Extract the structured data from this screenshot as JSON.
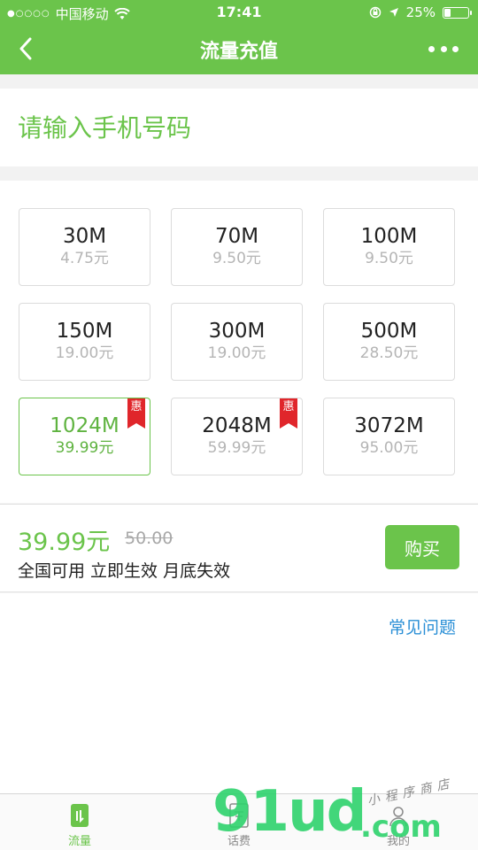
{
  "status_bar": {
    "carrier": "中国移动",
    "time": "17:41",
    "battery": "25%",
    "battery_level": 0.25
  },
  "nav": {
    "title": "流量充值",
    "back_icon": "chevron-left-icon",
    "more_icon": "more-dots-icon"
  },
  "phone": {
    "placeholder": "请输入手机号码",
    "value": ""
  },
  "packages": [
    {
      "size": "30M",
      "price": "4.75元",
      "selected": false,
      "badge": ""
    },
    {
      "size": "70M",
      "price": "9.50元",
      "selected": false,
      "badge": ""
    },
    {
      "size": "100M",
      "price": "9.50元",
      "selected": false,
      "badge": ""
    },
    {
      "size": "150M",
      "price": "19.00元",
      "selected": false,
      "badge": ""
    },
    {
      "size": "300M",
      "price": "19.00元",
      "selected": false,
      "badge": ""
    },
    {
      "size": "500M",
      "price": "28.50元",
      "selected": false,
      "badge": ""
    },
    {
      "size": "1024M",
      "price": "39.99元",
      "selected": true,
      "badge": "惠"
    },
    {
      "size": "2048M",
      "price": "59.99元",
      "selected": false,
      "badge": "惠"
    },
    {
      "size": "3072M",
      "price": "95.00元",
      "selected": false,
      "badge": ""
    }
  ],
  "purchase": {
    "price": "39.99元",
    "original_price": "50.00",
    "description": "全国可用 立即生效 月底失效",
    "buy_label": "购买"
  },
  "faq": {
    "label": "常见问题"
  },
  "tabbar": {
    "items": [
      {
        "label": "流量",
        "icon": "data-plan-icon",
        "active": true
      },
      {
        "label": "话费",
        "icon": "phone-bill-icon",
        "active": false
      },
      {
        "label": "我的",
        "icon": "profile-icon",
        "active": false
      }
    ]
  },
  "watermark": {
    "main": "91ud",
    "dotcom": ".com",
    "tagline": "小程序商店"
  },
  "colors": {
    "primary": "#6bc44b",
    "badge": "#e0262b",
    "link": "#2a8fd6"
  }
}
